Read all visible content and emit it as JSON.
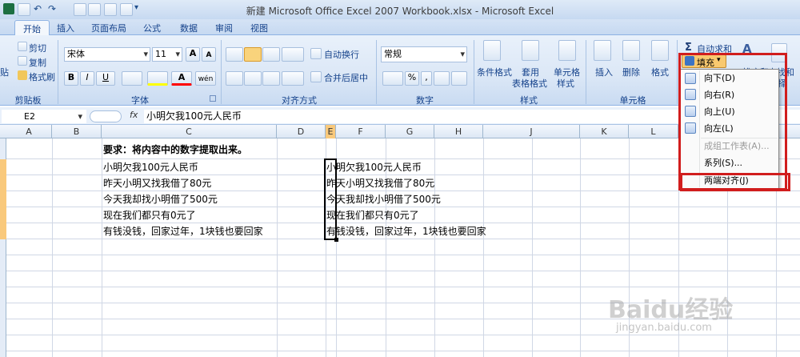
{
  "window": {
    "title": "新建 Microsoft Office Excel 2007 Workbook.xlsx - Microsoft Excel"
  },
  "tabs": [
    {
      "label": "开始"
    },
    {
      "label": "插入"
    },
    {
      "label": "页面布局"
    },
    {
      "label": "公式"
    },
    {
      "label": "数据"
    },
    {
      "label": "审阅"
    },
    {
      "label": "视图"
    }
  ],
  "ribbon": {
    "clipboard": {
      "paste": "贴",
      "cut": "剪切",
      "copy": "复制",
      "format_painter": "格式刷",
      "group": "剪贴板"
    },
    "font": {
      "name": "宋体",
      "size": "11",
      "bold": "B",
      "italic": "I",
      "underline": "U",
      "group": "字体",
      "phonetic": "wén"
    },
    "alignment": {
      "wrap": "自动换行",
      "merge": "合并后居中",
      "group": "对齐方式"
    },
    "number": {
      "format": "常规",
      "percent": "%",
      "comma": ",",
      "group": "数字"
    },
    "styles": {
      "conditional": "条件格式",
      "table1": "套用",
      "table2": "表格格式",
      "cell_style1": "单元格",
      "cell_style2": "样式",
      "group": "样式"
    },
    "cells": {
      "insert": "插入",
      "delete": "删除",
      "format": "格式",
      "group": "单元格"
    },
    "editing": {
      "autosum": "自动求和",
      "sort": "排序和",
      "find": "查找和",
      "find2": "择"
    }
  },
  "formula_bar": {
    "name_box": "E2",
    "fx": "fx",
    "content": "小明欠我100元人民币"
  },
  "columns": [
    "A",
    "B",
    "C",
    "D",
    "E",
    "F",
    "G",
    "H",
    "J",
    "K",
    "L"
  ],
  "cells": {
    "c1": "要求：将内容中的数字提取出来。",
    "c2": "小明欠我100元人民币",
    "c3": "昨天小明又找我借了80元",
    "c4": "今天我却找小明借了500元",
    "c5": "现在我们都只有0元了",
    "c6": "有钱没钱，回家过年，1块钱也要回家",
    "e2": "小明欠我100元人民币",
    "e3": "昨天小明又找我借了80元",
    "e4": "今天我却找小明借了500元",
    "e5": "现在我们都只有0元了",
    "e6": "有钱没钱，回家过年，1块钱也要回家"
  },
  "fill_menu": {
    "button": "填充",
    "items": [
      {
        "label": "向下(D)",
        "enabled": true
      },
      {
        "label": "向右(R)",
        "enabled": true
      },
      {
        "label": "向上(U)",
        "enabled": true
      },
      {
        "label": "向左(L)",
        "enabled": true
      },
      {
        "label": "成组工作表(A)...",
        "enabled": false
      },
      {
        "label": "系列(S)...",
        "enabled": true
      },
      {
        "label": "两端对齐(J)",
        "enabled": true
      }
    ]
  },
  "watermark": {
    "brand": "Baidu经验",
    "url": "jingyan.baidu.com"
  },
  "colors": {
    "highlight": "#d11d1d",
    "ribbon": "#dbe7f6",
    "row_selected": "#f9c97c"
  }
}
